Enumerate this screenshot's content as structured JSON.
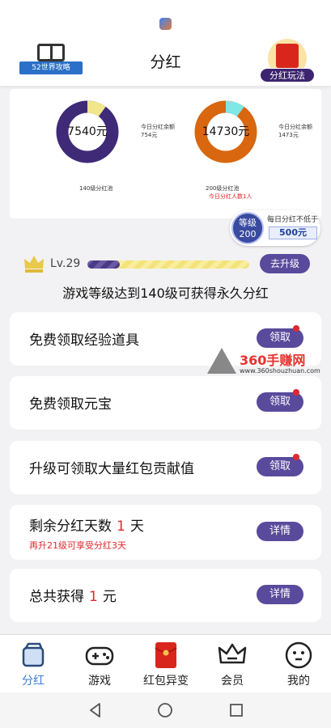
{
  "header": {
    "title": "分红",
    "left_logo_text": "52世界攻略",
    "right_logo_text": "分红玩法"
  },
  "stats": {
    "left": {
      "value": "7540元",
      "legend_top": "今日分红余额",
      "legend_top_value": "754元",
      "caption": "140级分红池"
    },
    "right": {
      "value": "14730元",
      "legend_top": "今日分红余额",
      "legend_top_value": "1473元",
      "caption": "200级分红池",
      "caption2": "今日分红人数1人"
    }
  },
  "level_badge": {
    "circle_title": "等级",
    "circle_value": "200",
    "line1": "每日分红不低于",
    "line2": "500元"
  },
  "level": {
    "text": "Lv.29",
    "progress": 0.2,
    "upgrade_button": "去升级",
    "description": "游戏等级达到140级可获得永久分红"
  },
  "cards": [
    {
      "label": "免费领取经验道具",
      "button": "领取",
      "dot": true
    },
    {
      "label": "免费领取元宝",
      "button": "领取",
      "dot": true
    },
    {
      "label": "升级可领取大量红包贡献值",
      "button": "领取",
      "dot": true
    },
    {
      "label_pre": "剩余分红天数",
      "label_num": "1",
      "label_post": "天",
      "sub": "再升21级可享受分红3天",
      "button": "详情"
    },
    {
      "label_pre": "总共获得",
      "label_num": "1",
      "label_post": "元",
      "button": "详情"
    }
  ],
  "watermark": {
    "title": "360手赚网",
    "url": "www.360shouzhuan.com"
  },
  "tabs": [
    {
      "label": "分红",
      "icon": "dividend-icon",
      "active": true
    },
    {
      "label": "游戏",
      "icon": "gamepad-icon"
    },
    {
      "label": "红包异变",
      "icon": "red-envelope-icon"
    },
    {
      "label": "会员",
      "icon": "crown-icon"
    },
    {
      "label": "我的",
      "icon": "face-icon"
    }
  ],
  "colors": {
    "accent": "#5a4a9c",
    "donut_left_main": "#3f2a78",
    "donut_left_rest": "#f1e68a",
    "donut_right_main": "#d8670f",
    "donut_right_rest": "#7fe7e4"
  }
}
